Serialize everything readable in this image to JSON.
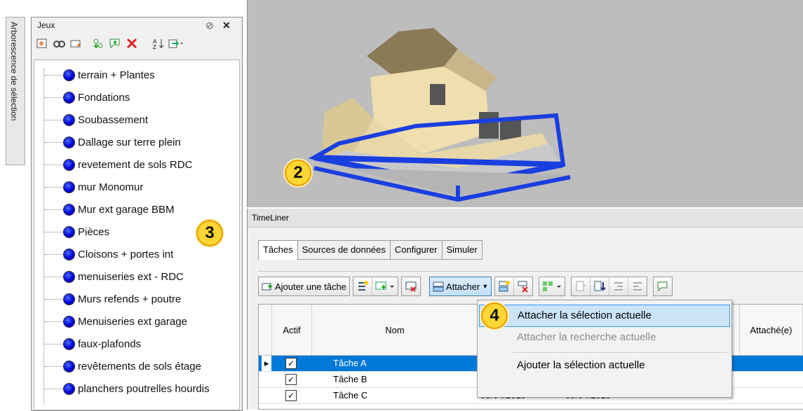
{
  "side_tab": {
    "label": "Arborescence de sélection"
  },
  "sets_panel": {
    "title": "Jeux",
    "pin_glyph": "⊘",
    "close_glyph": "✕",
    "items": [
      "terrain + Plantes",
      "Fondations",
      "Soubassement",
      "Dallage sur terre plein",
      "revetement de sols RDC",
      "mur Monomur",
      "Mur ext garage BBM",
      "Pièces",
      "Cloisons + portes int",
      "menuiseries ext - RDC",
      "Murs refends + poutre",
      "Menuiseries ext garage",
      "faux-plafonds",
      "revêtements de sols étage",
      "planchers poutrelles hourdis"
    ]
  },
  "timeliner": {
    "title": "TimeLiner",
    "tabs": [
      "Tâches",
      "Sources de données",
      "Configurer",
      "Simuler"
    ],
    "toolbar": {
      "add_task": "Ajouter une tâche",
      "attach": "Attacher"
    },
    "columns": {
      "active": "Actif",
      "name": "Nom",
      "attached": "Attaché(e)"
    },
    "rows": [
      {
        "name": "Tâche A",
        "start": "",
        "end": "",
        "checked": "✓",
        "selected": true
      },
      {
        "name": "Tâche B",
        "start": "",
        "end": "",
        "checked": "✓",
        "selected": false
      },
      {
        "name": "Tâche C",
        "start": "05/04/2019",
        "end": "09/04/2019",
        "checked": "✓",
        "selected": false
      }
    ],
    "row_marker": "▸"
  },
  "attach_menu": {
    "items": [
      {
        "label": "Attacher la sélection actuelle",
        "state": "highlighted"
      },
      {
        "label": "Attacher la recherche actuelle",
        "state": "disabled"
      },
      {
        "label": "Ajouter la sélection actuelle",
        "state": "enabled"
      }
    ]
  },
  "callouts": [
    "2",
    "3",
    "4"
  ],
  "colors": {
    "selection": "#0078d7",
    "callout": "#ffd633",
    "set_icon": "#0000d8",
    "slab_outline": "#1a3fe0"
  }
}
